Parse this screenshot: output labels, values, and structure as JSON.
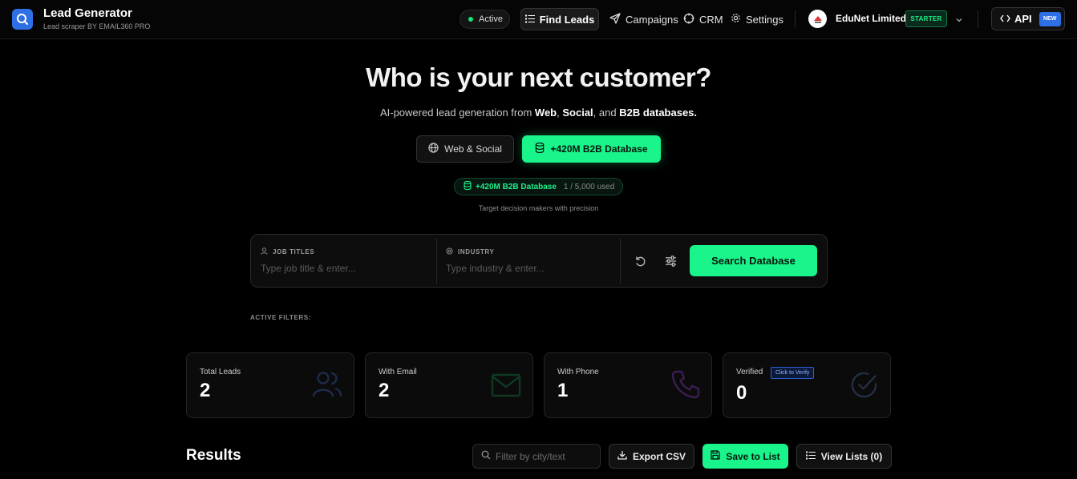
{
  "brand": {
    "title": "Lead Generator",
    "subtitle": "Lead scraper BY EMAIL360 PRO"
  },
  "status": {
    "label": "Active",
    "color": "#16e37a"
  },
  "nav": {
    "find_leads": "Find Leads",
    "campaigns": "Campaigns",
    "crm": "CRM",
    "settings": "Settings"
  },
  "org": {
    "name": "EduNet Limited",
    "plan": "STARTER"
  },
  "api": {
    "label": "API",
    "badge": "NEW"
  },
  "hero": {
    "title": "Who is your next customer?",
    "sub_prefix": "AI-powered lead generation from ",
    "sub_web": "Web",
    "sub_comma": ", ",
    "sub_social": "Social",
    "sub_and": ", and ",
    "sub_b2b": "B2B databases.",
    "mode_web": "Web & Social",
    "mode_b2b": "+420M B2B Database",
    "quota_label": "+420M B2B Database",
    "quota_used": "1 / 5,000 used",
    "hint": "Target decision makers with precision"
  },
  "search": {
    "job_label": "JOB TITLES",
    "job_placeholder": "Type job title & enter...",
    "industry_label": "INDUSTRY",
    "industry_placeholder": "Type industry & enter...",
    "button": "Search Database"
  },
  "filters": {
    "label": "ACTIVE FILTERS:"
  },
  "stats": [
    {
      "label": "Total Leads",
      "value": "2",
      "icon": "users-icon"
    },
    {
      "label": "With Email",
      "value": "2",
      "icon": "mail-icon"
    },
    {
      "label": "With Phone",
      "value": "1",
      "icon": "phone-icon"
    },
    {
      "label": "Verified",
      "value": "0",
      "icon": "check-circle-icon",
      "badge": "Click to Verify"
    }
  ],
  "results": {
    "title": "Results",
    "filter_placeholder": "Filter by city/text",
    "export": "Export CSV",
    "save": "Save to List",
    "view_lists": "View Lists (0)"
  },
  "colors": {
    "accent": "#19f58b",
    "brand_blue": "#2f6fe6"
  }
}
